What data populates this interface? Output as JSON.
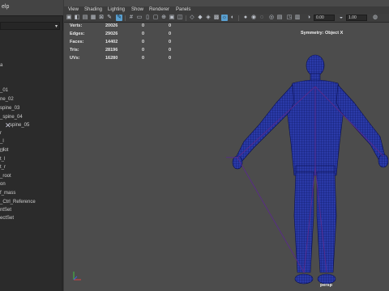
{
  "outliner": {
    "menu": [
      "elp"
    ],
    "items": [
      "a",
      "_01",
      "ne_02",
      "spine_03",
      "_spine_04",
      "spine_05",
      "r",
      "_l",
      "_r",
      "_l",
      "root",
      "t_l",
      "t_r",
      "_root",
      "on",
      "f_mass",
      "_Ctrl_Reference",
      "ntSet",
      "ectSet"
    ]
  },
  "viewport": {
    "menu": [
      "View",
      "Shading",
      "Lighting",
      "Show",
      "Renderer",
      "Panels"
    ],
    "toolbar": {
      "exposure_value": "0.00",
      "gamma_value": "1.00"
    },
    "hud": {
      "rows": [
        {
          "label": "Verts:",
          "v1": "20026",
          "v2": "0",
          "v3": "0"
        },
        {
          "label": "Edges:",
          "v1": "29026",
          "v2": "0",
          "v3": "0"
        },
        {
          "label": "Faces:",
          "v1": "14402",
          "v2": "0",
          "v3": "0"
        },
        {
          "label": "Tris:",
          "v1": "28196",
          "v2": "0",
          "v3": "0"
        },
        {
          "label": "UVs:",
          "v1": "16280",
          "v2": "0",
          "v3": "0"
        }
      ]
    },
    "symmetry": "Symmetry: Object X",
    "camera": "persp"
  },
  "icons": {
    "joint": "joint-icon",
    "axis": "axis-gizmo-icon"
  },
  "colors": {
    "wireframe": "#1a2a8c",
    "skeleton": "#5a2a8a",
    "viewport_bg": "#4c4c4c",
    "active_tool": "#5aa0d0"
  }
}
